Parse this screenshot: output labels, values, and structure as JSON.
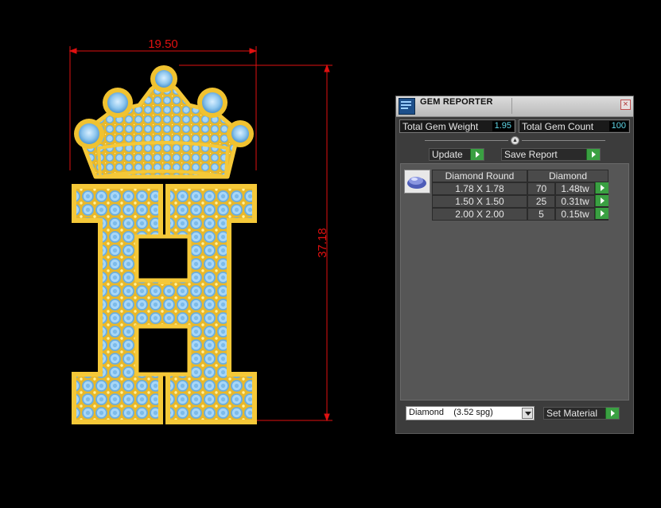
{
  "viewport": {
    "dim_width": "19.50",
    "dim_height": "37.18",
    "colors": {
      "dimension": "#e01010",
      "metal": "#f0c230",
      "gem": "#8ec6ee"
    }
  },
  "panel": {
    "title": "GEM REPORTER",
    "close_icon": "close-icon",
    "total_weight": {
      "label": "Total Gem Weight",
      "value": "1.95"
    },
    "total_count": {
      "label": "Total Gem Count",
      "value": "100"
    },
    "update_label": "Update",
    "save_report_label": "Save Report",
    "table": {
      "headers": [
        "Diamond Round",
        "Diamond"
      ],
      "rows": [
        {
          "size": "1.78 X 1.78",
          "count": "70",
          "weight": "1.48tw"
        },
        {
          "size": "1.50 X 1.50",
          "count": "25",
          "weight": "0.31tw"
        },
        {
          "size": "2.00 X 2.00",
          "count": "5",
          "weight": "0.15tw"
        }
      ]
    },
    "material_select": "Diamond    (3.52 spg)",
    "set_material_label": "Set Material",
    "colors": {
      "value_text": "#5fd7e8",
      "play_button": "#3aa042"
    }
  }
}
